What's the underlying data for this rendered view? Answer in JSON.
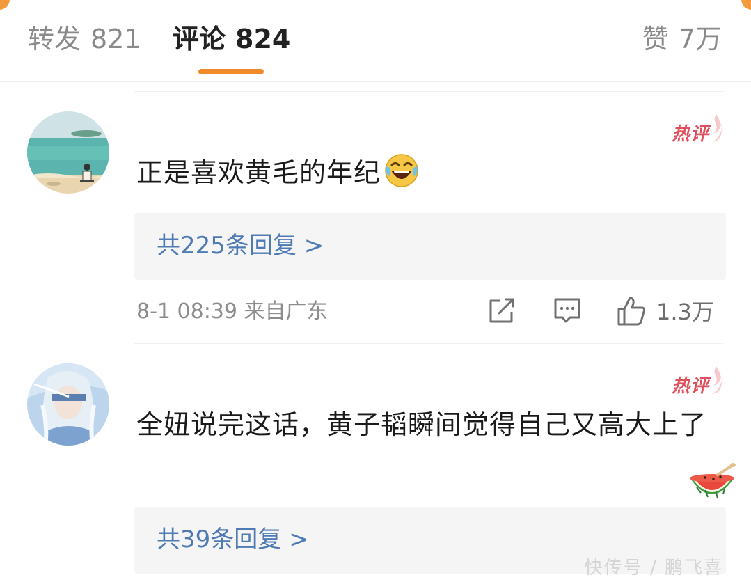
{
  "tabs": {
    "repost": {
      "label": "转发",
      "count": "821"
    },
    "comments": {
      "label": "评论",
      "count": "824"
    },
    "likes": {
      "label": "赞",
      "count": "7万"
    }
  },
  "hot_label": "热评",
  "comments": [
    {
      "text": "正是喜欢黄毛的年纪",
      "emoji": "laugh-cry-icon",
      "reply_summary": "共225条回复 >",
      "meta": "8-1 08:39 来自广东",
      "likes": "1.3万"
    },
    {
      "text": "全妞说完这话，黄子韬瞬间觉得自己又高大上了",
      "emoji": "watermelon-icon",
      "reply_summary": "共39条回复 >"
    }
  ],
  "watermark": "快传号 / 鹏飞喜",
  "colors": {
    "accent": "#f08b2c",
    "link": "#4f7bb5",
    "hot": "#e0505c"
  }
}
